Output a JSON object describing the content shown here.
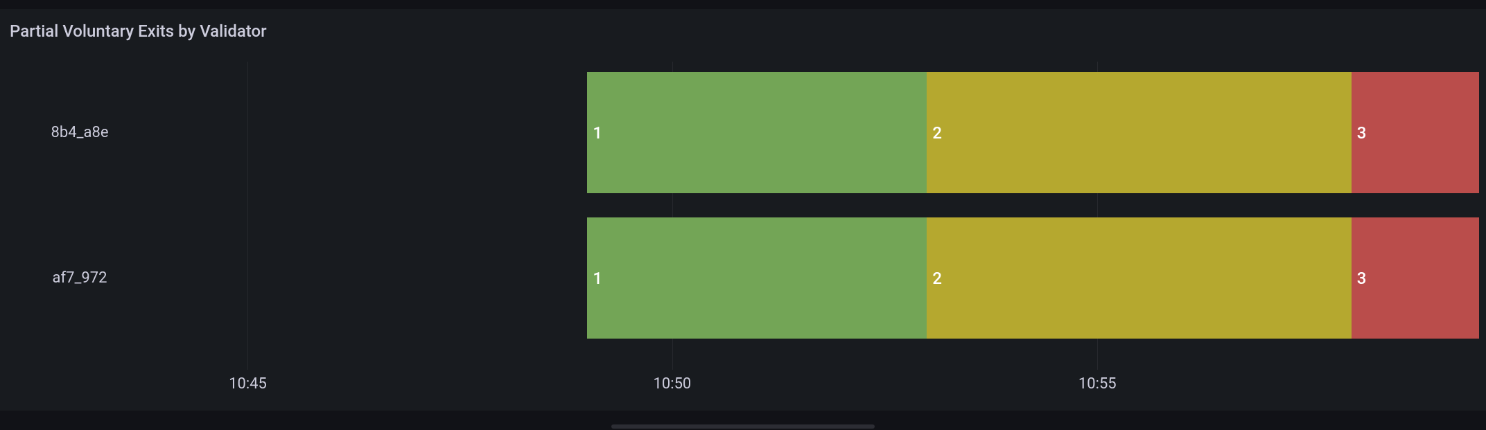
{
  "title": "Partial Voluntary Exits by Validator",
  "chart_data": {
    "type": "bar",
    "orientation": "horizontal",
    "categories": [
      "8b4_a8e",
      "af7_972"
    ],
    "x_ticks": [
      "10:45",
      "10:50",
      "10:55"
    ],
    "x_range_minutes": [
      44,
      59.5
    ],
    "series": [
      {
        "name": "1",
        "color": "#73a556",
        "start": "10:49",
        "end": "10:53"
      },
      {
        "name": "2",
        "color": "#b5a82f",
        "start": "10:53",
        "end": "10:58"
      },
      {
        "name": "3",
        "color": "#ba4d4b",
        "start": "10:58",
        "end": "10:59.5"
      }
    ],
    "rows": [
      {
        "label": "8b4_a8e",
        "segments": [
          {
            "value": 1
          },
          {
            "value": 2
          },
          {
            "value": 3
          }
        ]
      },
      {
        "label": "af7_972",
        "segments": [
          {
            "value": 1
          },
          {
            "value": 2
          },
          {
            "value": 3
          }
        ]
      }
    ]
  },
  "colors": {
    "green": "#73a556",
    "olive": "#b5a82f",
    "red": "#ba4d4b"
  }
}
